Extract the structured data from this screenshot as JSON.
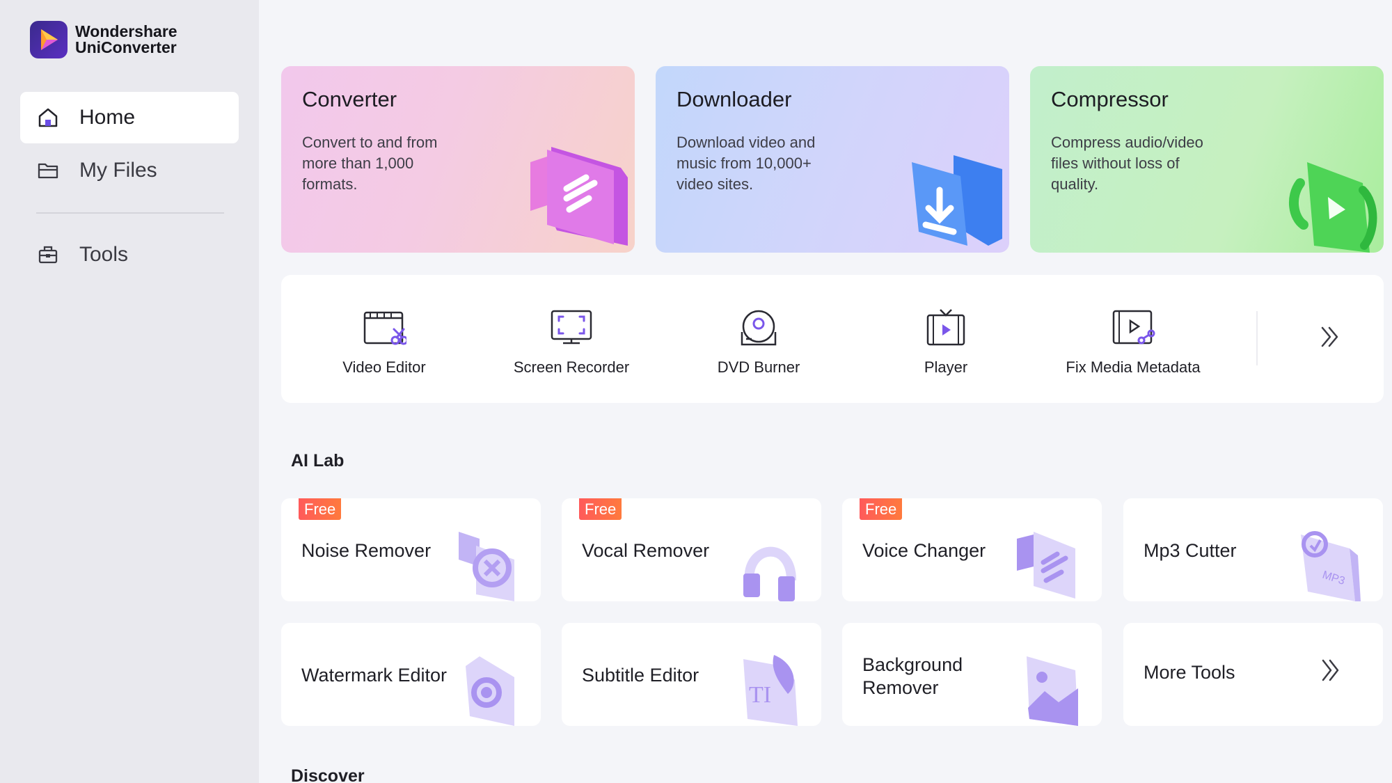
{
  "app": {
    "brand_line1": "Wondershare",
    "brand_line2": "UniConverter"
  },
  "sidebar": {
    "items": [
      {
        "label": "Home",
        "icon": "home-icon",
        "active": true
      },
      {
        "label": "My Files",
        "icon": "folder-icon",
        "active": false
      },
      {
        "label": "Tools",
        "icon": "toolbox-icon",
        "active": false
      }
    ]
  },
  "hero": [
    {
      "title": "Converter",
      "desc": "Convert to and from more than 1,000 formats."
    },
    {
      "title": "Downloader",
      "desc": "Download video and music from 10,000+ video sites."
    },
    {
      "title": "Compressor",
      "desc": "Compress audio/video files without loss of quality."
    }
  ],
  "tools": [
    {
      "label": "Video Editor",
      "icon": "video-editor-icon"
    },
    {
      "label": "Screen Recorder",
      "icon": "screen-recorder-icon"
    },
    {
      "label": "DVD Burner",
      "icon": "dvd-burner-icon"
    },
    {
      "label": "Player",
      "icon": "player-icon"
    },
    {
      "label": "Fix Media Metadata",
      "icon": "metadata-icon"
    }
  ],
  "ai_lab": {
    "title": "AI Lab",
    "badge": "Free",
    "cards": [
      {
        "label": "Noise Remover",
        "free": true
      },
      {
        "label": "Vocal Remover",
        "free": true
      },
      {
        "label": "Voice Changer",
        "free": true
      },
      {
        "label": "Mp3 Cutter",
        "free": false
      },
      {
        "label": "Watermark Editor",
        "free": false
      },
      {
        "label": "Subtitle Editor",
        "free": false
      },
      {
        "label": "Background Remover",
        "free": false
      },
      {
        "label": "More Tools",
        "free": false
      }
    ]
  },
  "discover": {
    "title": "Discover"
  },
  "colors": {
    "accent": "#6b4ee6",
    "badge": "#ff5f4e",
    "sidebar_bg": "#e9e9ee"
  }
}
